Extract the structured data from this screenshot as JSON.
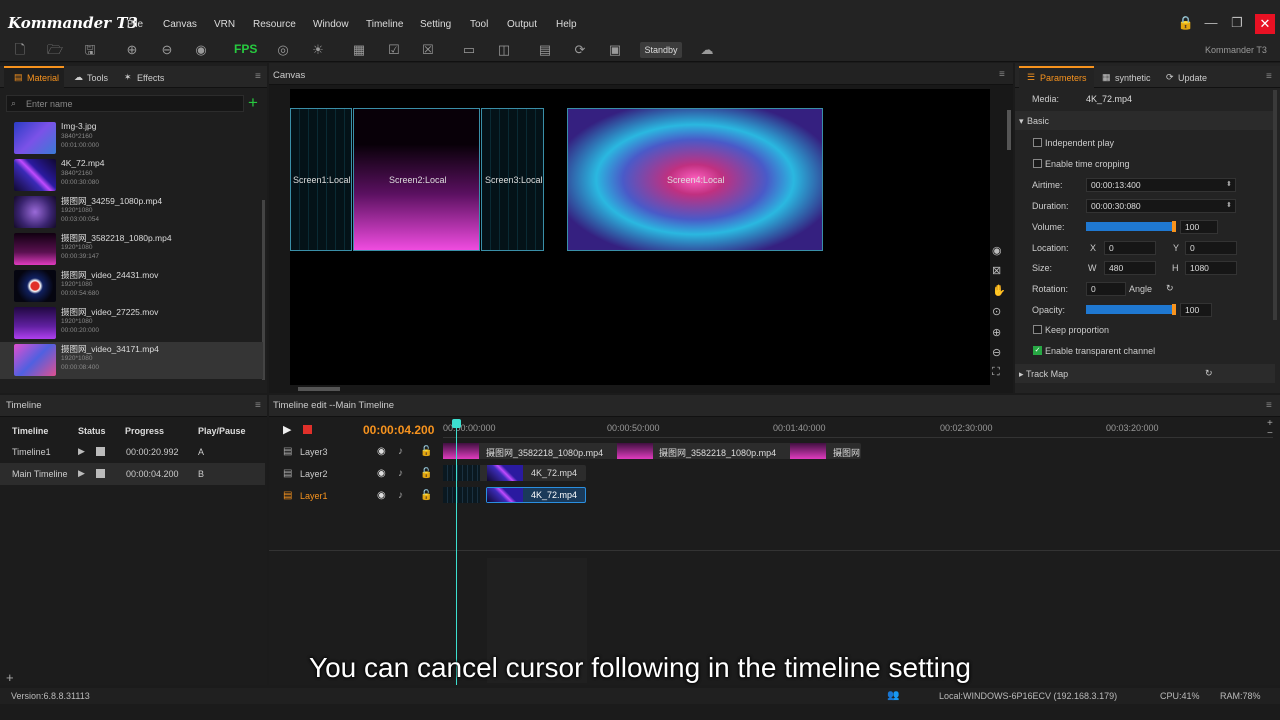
{
  "app": {
    "name": "Kommander T3",
    "brand_right": "Kommander T3"
  },
  "menu": [
    "File",
    "Canvas",
    "VRN",
    "Resource",
    "Window",
    "Timeline",
    "Setting",
    "Tool",
    "Output",
    "Help"
  ],
  "toolbar": {
    "fps_label": "FPS",
    "standby_label": "Standby"
  },
  "left_panel": {
    "tabs": [
      "Material",
      "Tools",
      "Effects"
    ],
    "search_placeholder": "Enter name",
    "media": [
      {
        "name": "Img-3.jpg",
        "res": "3840*2160",
        "dur": "00:01:00:000"
      },
      {
        "name": "4K_72.mp4",
        "res": "3840*2160",
        "dur": "00:00:30:080"
      },
      {
        "name": "摄图网_34259_1080p.mp4",
        "res": "1920*1080",
        "dur": "00:03:00:054"
      },
      {
        "name": "摄图网_3582218_1080p.mp4",
        "res": "1920*1080",
        "dur": "00:00:39:147"
      },
      {
        "name": "摄图网_video_24431.mov",
        "res": "1920*1080",
        "dur": "00:00:54:680"
      },
      {
        "name": "摄图网_video_27225.mov",
        "res": "1920*1080",
        "dur": "00:00:20:000"
      },
      {
        "name": "摄图网_video_34171.mp4",
        "res": "1920*1080",
        "dur": "00:00:08:400"
      }
    ]
  },
  "canvas": {
    "title": "Canvas",
    "screens": [
      "Screen1:Local",
      "Screen2:Local",
      "Screen3:Local",
      "Screen4:Local"
    ]
  },
  "right_panel": {
    "tabs": [
      "Parameters",
      "synthetic",
      "Update"
    ],
    "media_label": "Media:",
    "media_value": "4K_72.mp4",
    "basic_label": "Basic",
    "independent_play": "Independent play",
    "enable_time_cropping": "Enable time cropping",
    "airtime_label": "Airtime:",
    "airtime_value": "00:00:13:400",
    "duration_label": "Duration:",
    "duration_value": "00:00:30:080",
    "volume_label": "Volume:",
    "volume_value": "100",
    "location_label": "Location:",
    "x_label": "X",
    "x_value": "0",
    "y_label": "Y",
    "y_value": "0",
    "size_label": "Size:",
    "w_label": "W",
    "w_value": "480",
    "h_label": "H",
    "h_value": "1080",
    "rotation_label": "Rotation:",
    "rotation_value": "0",
    "angle_label": "Angle",
    "opacity_label": "Opacity:",
    "opacity_value": "100",
    "keep_proportion": "Keep proportion",
    "enable_transparent": "Enable transparent channel",
    "track_map": "Track Map"
  },
  "timeline_panel": {
    "title": "Timeline",
    "headers": [
      "Timeline",
      "Status",
      "Progress",
      "Play/Pause"
    ],
    "rows": [
      {
        "name": "Timeline1",
        "progress": "00:00:20.992",
        "key": "A"
      },
      {
        "name": "Main Timeline",
        "progress": "00:00:04.200",
        "key": "B"
      }
    ]
  },
  "edit_panel": {
    "title": "Timeline edit --Main Timeline",
    "current_time": "00:00:04.200",
    "ticks": [
      "00:00:00:000",
      "00:00:50:000",
      "00:01:40:000",
      "00:02:30:000",
      "00:03:20:000"
    ],
    "layers": [
      "Layer3",
      "Layer2",
      "Layer1"
    ],
    "clips": {
      "layer3": [
        "摄图网_3582218_1080p.mp4",
        "摄图网_3582218_1080p.mp4",
        "摄图网"
      ],
      "layer2": "4K_72.mp4",
      "layer1": "4K_72.mp4"
    }
  },
  "status": {
    "version": "Version:6.8.8.31113",
    "local": "Local:WINDOWS-6P16ECV (192.168.3.179)",
    "cpu": "CPU:41%",
    "ram": "RAM:78%"
  },
  "subtitle": "You can cancel cursor following in the timeline setting",
  "colors": {
    "accent": "#f7931e",
    "blue": "#1f78d1",
    "cyan": "#3ce0d0",
    "close": "#e81123",
    "green": "#27c93f"
  }
}
